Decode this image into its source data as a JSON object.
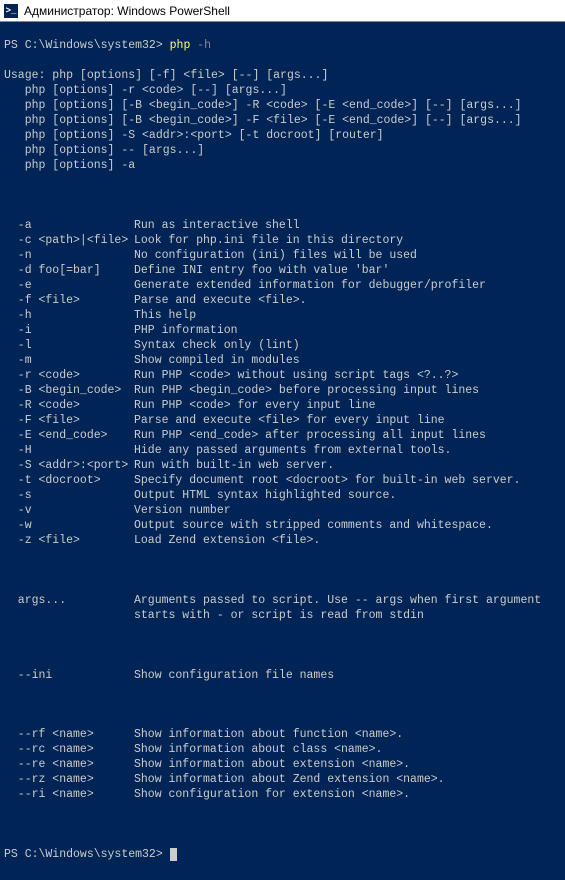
{
  "titlebar": {
    "icon_glyph": ">_",
    "title": "Администратор: Windows PowerShell"
  },
  "prompt1": {
    "path": "PS C:\\Windows\\system32> ",
    "cmd": "php ",
    "flag": "-h"
  },
  "usage": [
    "Usage: php [options] [-f] <file> [--] [args...]",
    "   php [options] -r <code> [--] [args...]",
    "   php [options] [-B <begin_code>] -R <code> [-E <end_code>] [--] [args...]",
    "   php [options] [-B <begin_code>] -F <file> [-E <end_code>] [--] [args...]",
    "   php [options] -S <addr>:<port> [-t docroot] [router]",
    "   php [options] -- [args...]",
    "   php [options] -a"
  ],
  "options": [
    {
      "opt": "  -a",
      "desc": "Run as interactive shell"
    },
    {
      "opt": "  -c <path>|<file>",
      "desc": "Look for php.ini file in this directory"
    },
    {
      "opt": "  -n",
      "desc": "No configuration (ini) files will be used"
    },
    {
      "opt": "  -d foo[=bar]",
      "desc": "Define INI entry foo with value 'bar'"
    },
    {
      "opt": "  -e",
      "desc": "Generate extended information for debugger/profiler"
    },
    {
      "opt": "  -f <file>",
      "desc": "Parse and execute <file>."
    },
    {
      "opt": "  -h",
      "desc": "This help"
    },
    {
      "opt": "  -i",
      "desc": "PHP information"
    },
    {
      "opt": "  -l",
      "desc": "Syntax check only (lint)"
    },
    {
      "opt": "  -m",
      "desc": "Show compiled in modules"
    },
    {
      "opt": "  -r <code>",
      "desc": "Run PHP <code> without using script tags <?..?>"
    },
    {
      "opt": "  -B <begin_code>",
      "desc": "Run PHP <begin_code> before processing input lines"
    },
    {
      "opt": "  -R <code>",
      "desc": "Run PHP <code> for every input line"
    },
    {
      "opt": "  -F <file>",
      "desc": "Parse and execute <file> for every input line"
    },
    {
      "opt": "  -E <end_code>",
      "desc": "Run PHP <end_code> after processing all input lines"
    },
    {
      "opt": "  -H",
      "desc": "Hide any passed arguments from external tools."
    },
    {
      "opt": "  -S <addr>:<port>",
      "desc": "Run with built-in web server."
    },
    {
      "opt": "  -t <docroot>",
      "desc": "Specify document root <docroot> for built-in web server."
    },
    {
      "opt": "  -s",
      "desc": "Output HTML syntax highlighted source."
    },
    {
      "opt": "  -v",
      "desc": "Version number"
    },
    {
      "opt": "  -w",
      "desc": "Output source with stripped comments and whitespace."
    },
    {
      "opt": "  -z <file>",
      "desc": "Load Zend extension <file>."
    }
  ],
  "args_block": [
    {
      "opt": "  args...",
      "desc": "Arguments passed to script. Use -- args when first argument"
    },
    {
      "opt": "",
      "desc": "starts with - or script is read from stdin"
    }
  ],
  "ini_block": [
    {
      "opt": "  --ini",
      "desc": "Show configuration file names"
    }
  ],
  "name_block": [
    {
      "opt": "  --rf <name>",
      "desc": "Show information about function <name>."
    },
    {
      "opt": "  --rc <name>",
      "desc": "Show information about class <name>."
    },
    {
      "opt": "  --re <name>",
      "desc": "Show information about extension <name>."
    },
    {
      "opt": "  --rz <name>",
      "desc": "Show information about Zend extension <name>."
    },
    {
      "opt": "  --ri <name>",
      "desc": "Show configuration for extension <name>."
    }
  ],
  "prompt2": "PS C:\\Windows\\system32> "
}
